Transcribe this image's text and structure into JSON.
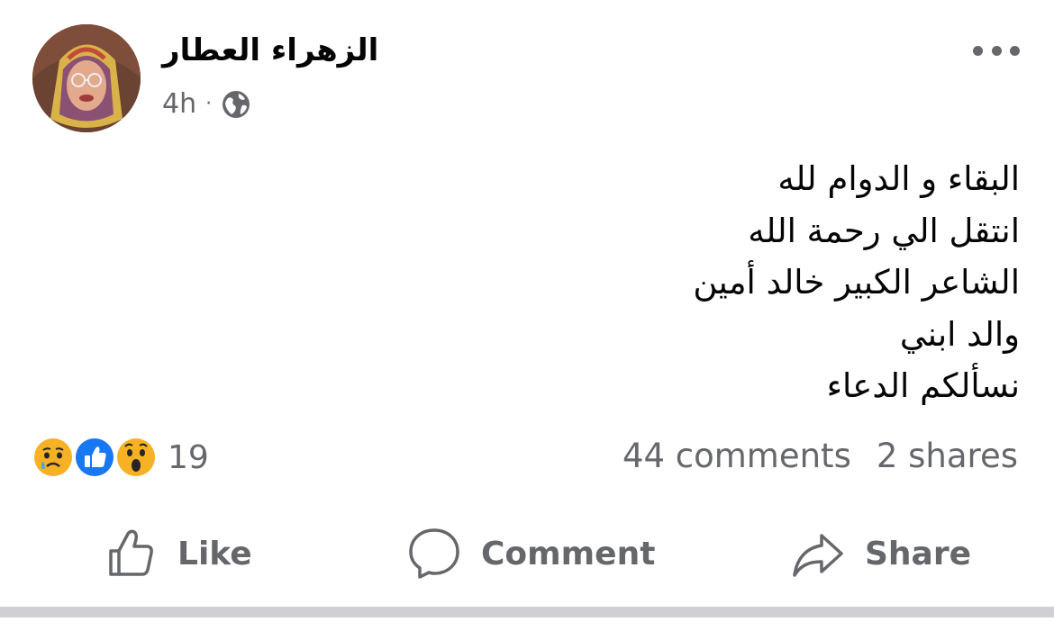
{
  "post": {
    "author_name": "الزهراء العطار",
    "time_ago": "4h",
    "separator": "·",
    "privacy_icon": "globe-icon",
    "more_icon": "more-options-icon",
    "text_lines": [
      "البقاء و الدوام لله",
      "انتقل الي رحمة الله",
      "الشاعر الكبير خالد أمين",
      "والد ابني",
      "نسألكم الدعاء"
    ]
  },
  "engagement": {
    "reaction_icons": [
      "sad-reaction-icon",
      "like-reaction-icon",
      "wow-reaction-icon"
    ],
    "reaction_count": "19",
    "comments": "44 comments",
    "shares": "2 shares"
  },
  "actions": {
    "like_label": "Like",
    "comment_label": "Comment",
    "share_label": "Share"
  },
  "colors": {
    "secondary_text": "#65676b",
    "primary_text": "#050505",
    "like_blue": "#1877f2",
    "reaction_yellow": "#f7b125",
    "divider": "#cfd0d3"
  }
}
